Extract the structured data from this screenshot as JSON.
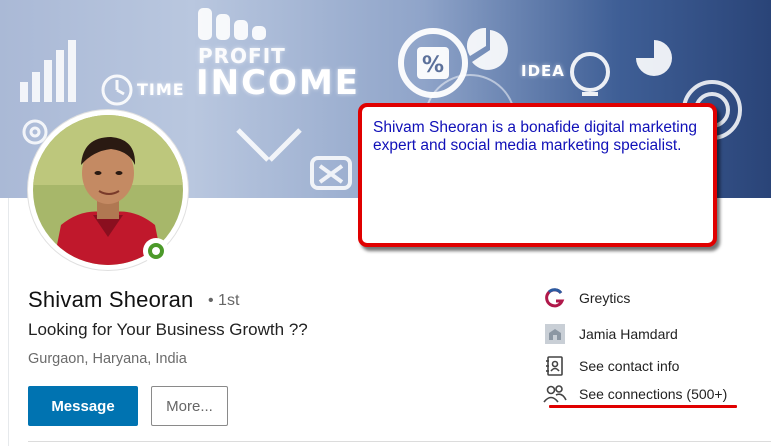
{
  "banner": {
    "words": {
      "profit": "PROFIT",
      "income": "INCOME",
      "time": "TIME",
      "idea": "IDEA",
      "percent": "%"
    }
  },
  "annotation": {
    "text": "Shivam Sheoran is a bonafide digital marketing expert and social media marketing specialist.",
    "border_color": "#e00000",
    "text_color": "#1010b8"
  },
  "profile": {
    "name": "Shivam Sheoran",
    "degree": "• 1st",
    "headline": "Looking for Your Business Growth ??",
    "location": "Gurgaon, Haryana, India",
    "status_color": "#4c9a2a"
  },
  "actions": {
    "message_label": "Message",
    "more_label": "More...",
    "primary_color": "#0073b1"
  },
  "sidebar": {
    "items": [
      {
        "label": "Greytics",
        "icon": "greytics-logo-icon"
      },
      {
        "label": "Jamia Hamdard",
        "icon": "school-building-icon"
      },
      {
        "label": "See contact info",
        "icon": "contact-book-icon"
      },
      {
        "label": "See connections (500+)",
        "icon": "people-icon"
      }
    ]
  }
}
